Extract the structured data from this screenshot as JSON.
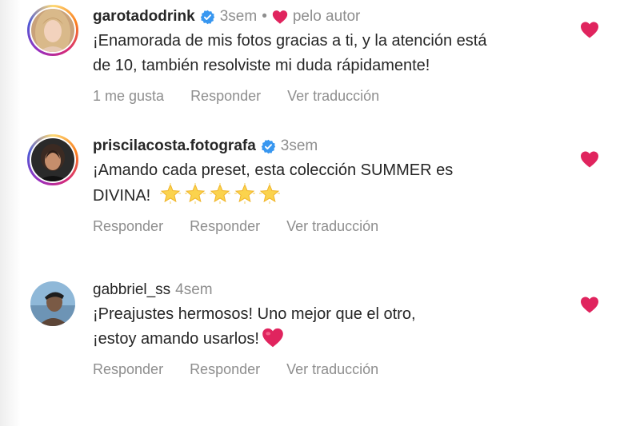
{
  "comments": [
    {
      "username": "garotadodrink",
      "time": "3sem",
      "separator": "•",
      "author_label": "pelo autor",
      "text_line1": "¡Enamorada de mis fotos gracias a ti, y la atención está",
      "text_line2": "de 10, también resolviste mi duda rápidamente!",
      "action1": "1 me gusta",
      "action2": "Responder",
      "action3": "Ver traducción"
    },
    {
      "username": "priscilacosta.fotografa",
      "time": "3sem",
      "text_line1": "¡Amando cada preset, esta colección SUMMER es",
      "text_line2": "DIVINA!",
      "action1": "Responder",
      "action2": "Responder",
      "action3": "Ver traducción"
    },
    {
      "username": "gabbriel_ss",
      "time": "4sem",
      "text_line1": "¡Preajustes hermosos! Uno mejor que el otro,",
      "text_line2": "¡estoy amando usarlos!",
      "action1": "Responder",
      "action2": "Responder",
      "action3": "Ver traducción"
    }
  ],
  "icons": {
    "verified": "verified-badge-icon",
    "heart": "heart-icon",
    "star": "glowing-star-emoji"
  },
  "colors": {
    "heart": "#e0245e",
    "verified": "#3897f0",
    "muted": "#8e8e8e",
    "text": "#262626"
  }
}
